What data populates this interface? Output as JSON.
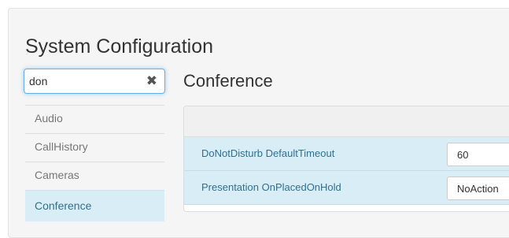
{
  "page": {
    "title": "System Configuration"
  },
  "search": {
    "value": "don",
    "clear_icon": "close-icon"
  },
  "sidebar": {
    "items": [
      {
        "label": "Audio",
        "active": false
      },
      {
        "label": "CallHistory",
        "active": false
      },
      {
        "label": "Cameras",
        "active": false
      },
      {
        "label": "Conference",
        "active": true
      }
    ]
  },
  "main": {
    "section_title": "Conference",
    "settings": [
      {
        "label": "DoNotDisturb DefaultTimeout",
        "value": "60"
      },
      {
        "label": "Presentation OnPlacedOnHold",
        "value": "NoAction"
      }
    ]
  },
  "colors": {
    "accent_bg": "#d9edf7",
    "accent_text": "#31708f",
    "focus_border": "#66afe9"
  }
}
